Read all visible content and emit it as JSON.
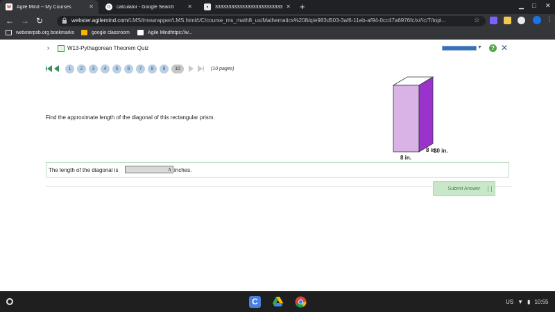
{
  "browser": {
    "tabs": [
      {
        "title": "Agile Mind -- My Courses",
        "icon": "agile-mind-icon",
        "active": true
      },
      {
        "title": "calculator - Google Search",
        "icon": "google-icon",
        "active": false
      },
      {
        "title": "3333333333333333333333333",
        "icon": "generic-page-icon",
        "active": false
      }
    ],
    "new_tab_label": "+",
    "window_controls": {
      "minimize": "▁",
      "maximize": "□",
      "close": "✕"
    },
    "url_host": "webster.agilemind.com",
    "url_path": "/LMS/lmswrapper/LMS.html#/C/course_ms_math8_us/Mathematics%208/q/e983d503-3af6-11eb-af94-0cc47a6976fc/x///c/T/topi...",
    "bookmarks": [
      {
        "label": "websterpsb.org bookmarks",
        "icon": "folder-icon"
      },
      {
        "label": "google classroom",
        "icon": "classroom-icon"
      },
      {
        "label": "Agile Mindhttps://w...",
        "icon": "agile-mind-icon"
      }
    ]
  },
  "quiz": {
    "title": "W13-Pythagorean Theorem Quiz",
    "progress_fraction": 1.0,
    "help_label": "?",
    "close_label": "✕"
  },
  "pager": {
    "pages": [
      "1",
      "2",
      "3",
      "4",
      "5",
      "6",
      "7",
      "8",
      "9",
      "10"
    ],
    "current": "10",
    "count_label": "(10 pages)"
  },
  "question": {
    "prompt": "Find the approximate length of the diagonal of this rectangular prism.",
    "figure": {
      "height_label": "20 in.",
      "depth_label": "8 in.",
      "width_label": "8 in.",
      "colors": {
        "front": "#d9b3e6",
        "side": "#9933cc",
        "top": "#ffffff",
        "edge": "#333333"
      }
    },
    "answer_prefix": "The length of the diagonal is",
    "answer_value": "",
    "answer_glyph": "A",
    "answer_suffix": "inches.",
    "submit_label": "Submit Answer"
  },
  "shelf": {
    "apps": [
      "classroom-app-icon",
      "drive-app-icon",
      "chrome-app-icon"
    ],
    "locale": "US",
    "time": "10:55"
  },
  "colors": {
    "chrome_dark": "#202124",
    "chrome_mid": "#35363a",
    "accent_green": "#3a8f5a",
    "progress_blue": "#3572b8",
    "submit_bg": "#c9e8c9"
  }
}
